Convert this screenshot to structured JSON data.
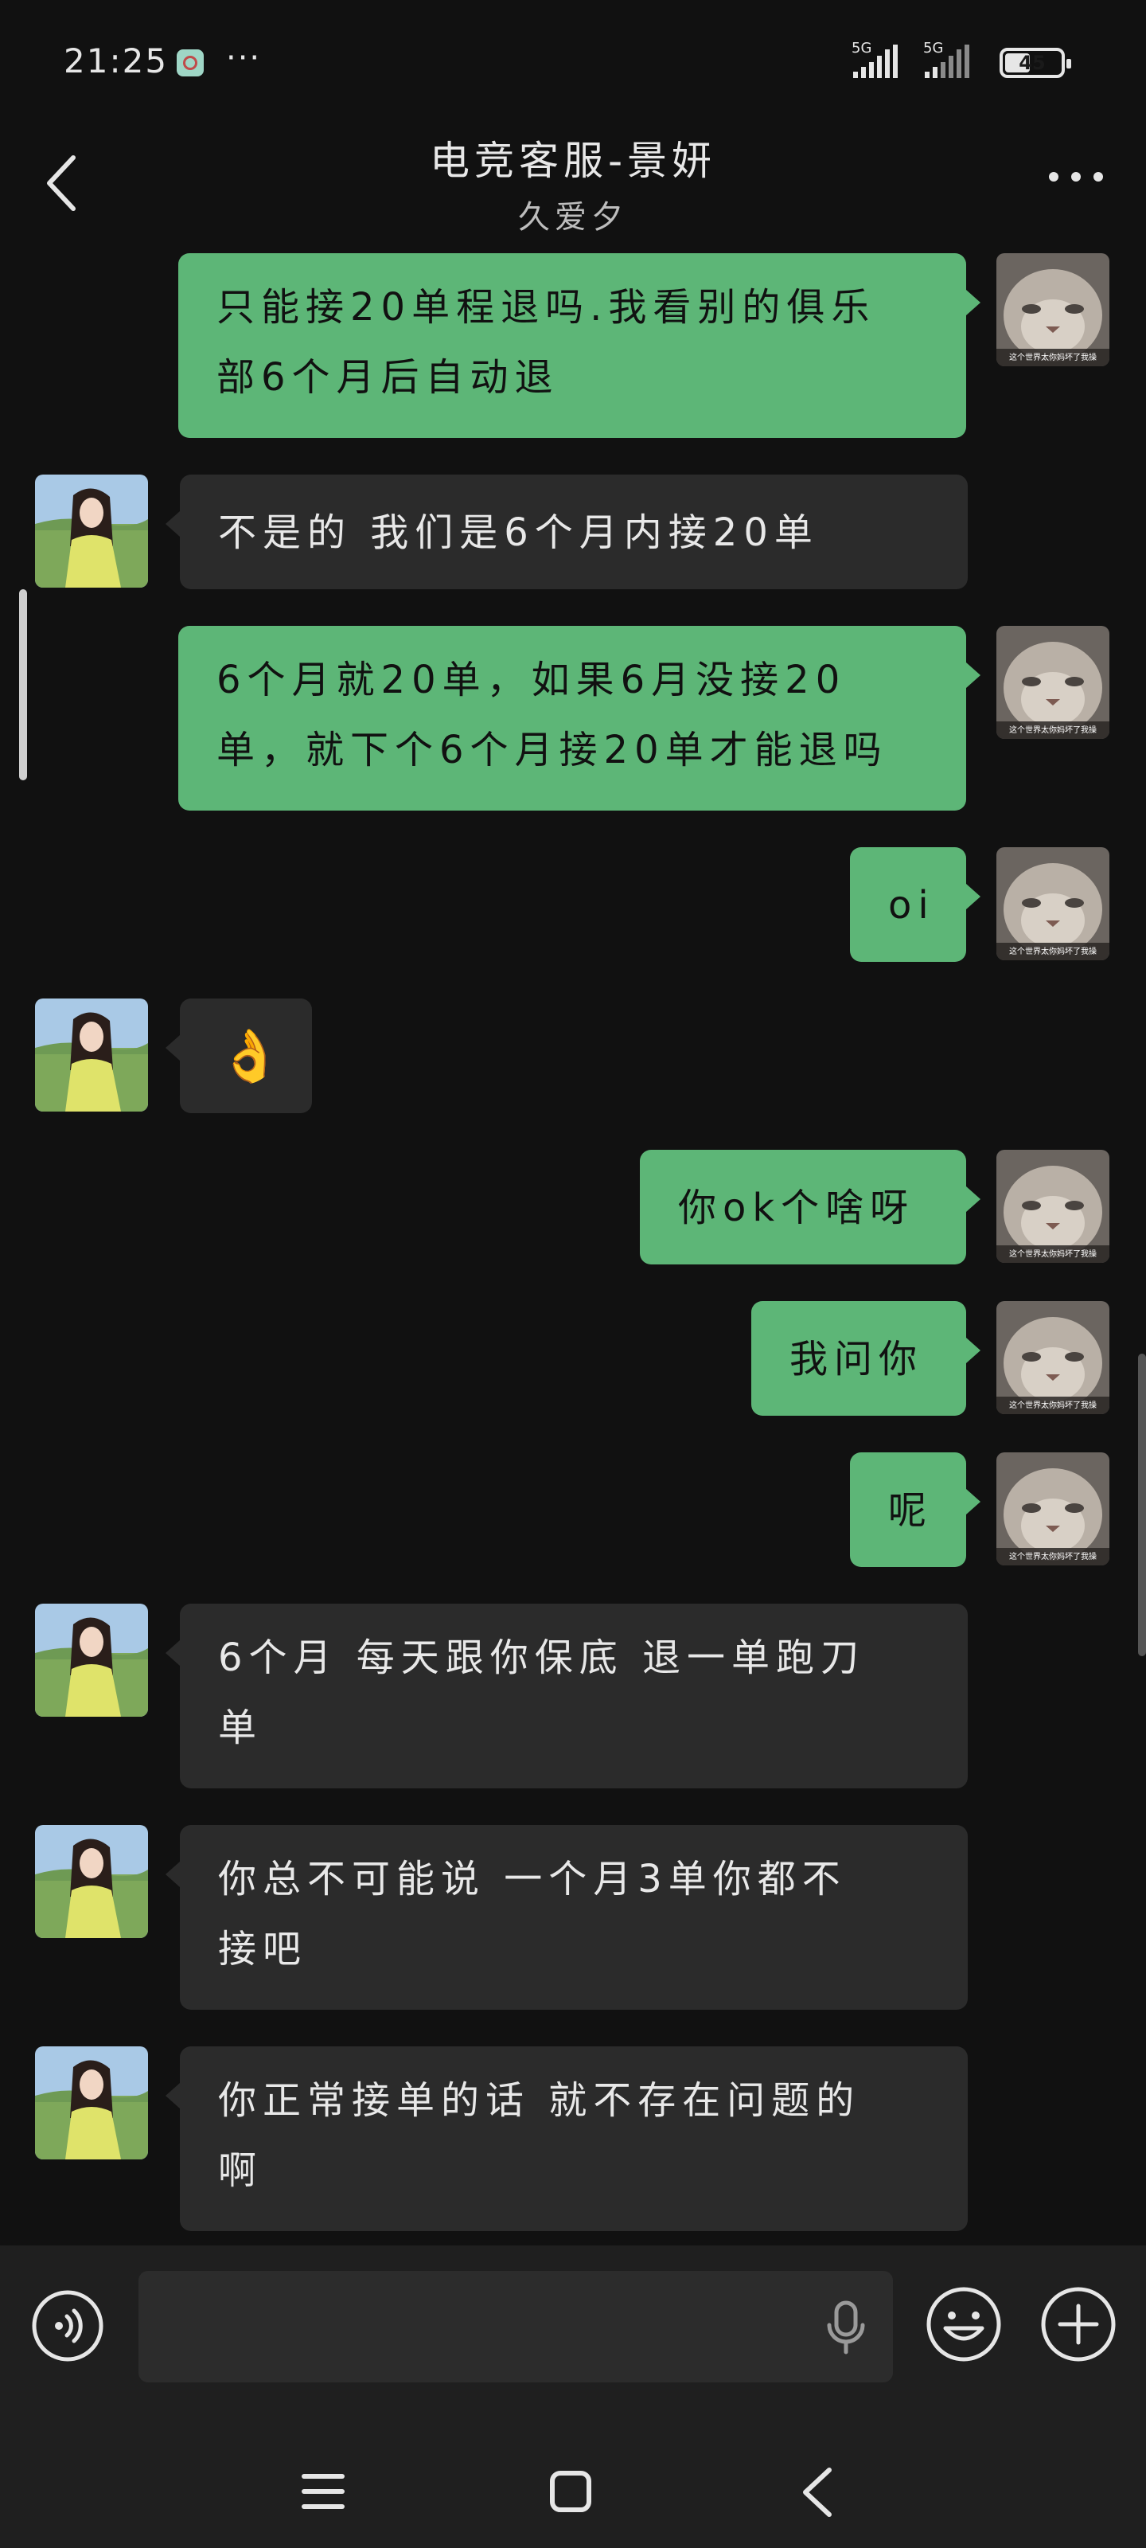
{
  "status_bar": {
    "time": "21:25",
    "more": "···",
    "network_1": "5G",
    "network_2": "5G",
    "battery": "45",
    "battery_level": 0.45
  },
  "header": {
    "title": "电竞客服-景妍",
    "subtitle": "久爱夕"
  },
  "messages": [
    {
      "side": "out",
      "lines": [
        "只能接20单程退吗.我看别的俱乐",
        "部6个月后自动退"
      ]
    },
    {
      "side": "in",
      "lines": [
        "不是的 我们是6个月内接20单"
      ]
    },
    {
      "side": "out",
      "lines": [
        "6个月就20单，如果6月没接20",
        "单，就下个6个月接20单才能退吗"
      ]
    },
    {
      "side": "out",
      "lines": [
        "oi"
      ]
    },
    {
      "side": "in",
      "lines": [
        "👌"
      ]
    },
    {
      "side": "out",
      "lines": [
        "你ok个啥呀"
      ]
    },
    {
      "side": "out",
      "lines": [
        "我问你"
      ]
    },
    {
      "side": "out",
      "lines": [
        "呢"
      ]
    },
    {
      "side": "in",
      "lines": [
        "6个月 每天跟你保底 退一单跑刀",
        "单"
      ]
    },
    {
      "side": "in",
      "lines": [
        "你总不可能说 一个月3单你都不",
        "接吧"
      ]
    },
    {
      "side": "in",
      "lines": [
        "你正常接单的话 就不存在问题的",
        "啊"
      ]
    }
  ],
  "self_avatar": {
    "caption": "这个世界太你妈坏了我操",
    "icon": "cat-avatar"
  },
  "contact_avatar": {
    "icon": "girl-meadow-avatar"
  },
  "input_bar": {
    "text": "",
    "icons": [
      "voice-icon",
      "microphone-icon",
      "emoji-icon",
      "plus-icon"
    ]
  },
  "nav_bar": {
    "icons": [
      "menu-icon",
      "home-icon",
      "back-icon"
    ]
  },
  "colors": {
    "background": "#111111",
    "outgoing_bubble": "#5db677",
    "incoming_bubble": "#2b2b2b"
  }
}
